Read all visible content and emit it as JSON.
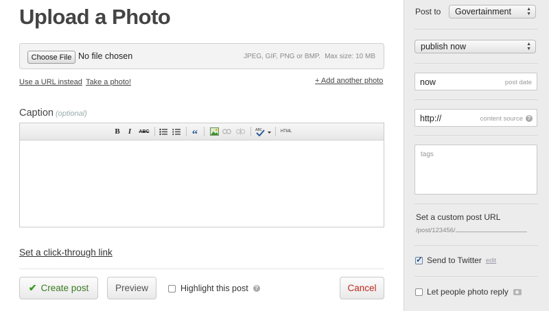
{
  "page": {
    "title": "Upload a Photo"
  },
  "upload": {
    "choose_file_label": "Choose File",
    "no_file_text": "No file chosen",
    "formats": "JPEG, GIF, PNG or BMP.",
    "max_size": "Max size: 10 MB",
    "use_url_link": "Use a URL instead",
    "take_photo_link": "Take a photo!",
    "add_another_link": "+ Add another photo"
  },
  "caption": {
    "label": "Caption",
    "optional": "(optional)",
    "toolbar": {
      "bold": "B",
      "italic": "I",
      "strike": "ABC",
      "quote": "“",
      "html": "HTML",
      "spell": "ABC"
    },
    "body": ""
  },
  "clickthrough_link": "Set a click-through link",
  "actions": {
    "create_label": "Create post",
    "preview_label": "Preview",
    "highlight_label": "Highlight this post",
    "cancel_label": "Cancel"
  },
  "sidebar": {
    "post_to_label": "Post to",
    "post_to_value": "Govertainment",
    "publish_value": "publish now",
    "post_date_value": "now",
    "post_date_hint": "post date",
    "source_value": "http://",
    "source_hint": "content source",
    "tags_placeholder": "tags",
    "custom_url_label": "Set a custom post URL",
    "custom_url_prefix": "/post/123456/",
    "send_twitter_label": "Send to Twitter",
    "send_twitter_edit": "edit",
    "photo_reply_label": "Let people photo reply"
  },
  "colors": {
    "create_text": "#3a7a23",
    "cancel_text": "#c0291f",
    "sidebar_bg": "#ececec"
  }
}
